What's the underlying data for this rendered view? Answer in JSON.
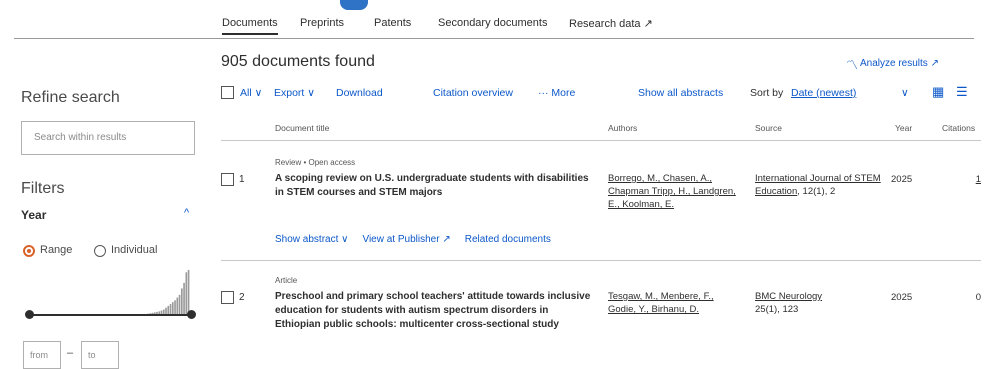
{
  "tabs": [
    {
      "label": "Documents",
      "active": true
    },
    {
      "label": "Preprints",
      "active": false
    },
    {
      "label": "Patents",
      "active": false
    },
    {
      "label": "Secondary documents",
      "active": false
    },
    {
      "label": "Research data ↗",
      "active": false
    }
  ],
  "sidebar": {
    "refine_title": "Refine search",
    "search_placeholder": "Search within results",
    "filters_title": "Filters",
    "year_label": "Year",
    "range_label": "Range",
    "individual_label": "Individual",
    "selected_mode": "Range",
    "histogram_values": [
      1,
      1,
      1,
      1,
      1,
      1,
      1,
      1,
      1,
      1,
      1,
      1,
      1,
      1,
      1,
      1,
      1,
      1,
      1,
      1,
      1,
      1,
      1,
      1,
      1,
      1,
      1,
      1,
      1,
      1,
      1,
      1,
      1,
      1,
      1,
      1,
      1,
      1,
      1,
      1,
      1,
      1,
      1,
      2,
      2,
      2,
      2,
      3,
      3,
      3,
      4,
      4,
      5,
      6,
      7,
      8,
      9,
      10,
      12,
      14,
      18,
      22,
      26,
      30,
      34,
      40,
      46,
      60,
      72,
      95,
      100
    ],
    "from_placeholder": "from",
    "to_placeholder": "to",
    "dash": "–"
  },
  "main": {
    "result_count": "905 documents found",
    "analyze_label": "Analyze results ↗",
    "toolbar": {
      "all": "All ∨",
      "export": "Export ∨",
      "download": "Download",
      "citation_overview": "Citation overview",
      "more": "··· More",
      "show_all_abstracts": "Show all abstracts",
      "sort_by_label": "Sort by",
      "sort_value": "Date (newest)",
      "sort_chevron": "∨"
    },
    "columns": {
      "title": "Document title",
      "authors": "Authors",
      "source": "Source",
      "year": "Year",
      "citations": "Citations"
    },
    "results": [
      {
        "number": "1",
        "type": "Review • Open access",
        "title": "A scoping review on U.S. undergraduate students with disabilities in STEM courses and STEM majors",
        "authors": "Borrego, M., Chasen, A., Chapman Tripp, H., Landgren, E., Koolman, E.",
        "source_name": "International Journal of STEM Education",
        "source_detail": ", 12(1), 2",
        "year": "2025",
        "citations": "1",
        "actions": [
          "Show abstract ∨",
          "View at Publisher ↗",
          "Related documents"
        ]
      },
      {
        "number": "2",
        "type": "Article",
        "title": "Preschool and primary school teachers' attitude towards inclusive education for students with autism spectrum disorders in Ethiopian public schools: multicenter cross-sectional study",
        "authors": "Tesgaw, M., Menbere, F., Godie, Y., Birhanu, D.",
        "source_name": "BMC Neurology",
        "source_detail": "25(1), 123",
        "year": "2025",
        "citations": "0"
      }
    ]
  },
  "colors": {
    "link": "#0c58c9",
    "radio_selected": "#d9622b",
    "text": "#2e2e2e"
  }
}
